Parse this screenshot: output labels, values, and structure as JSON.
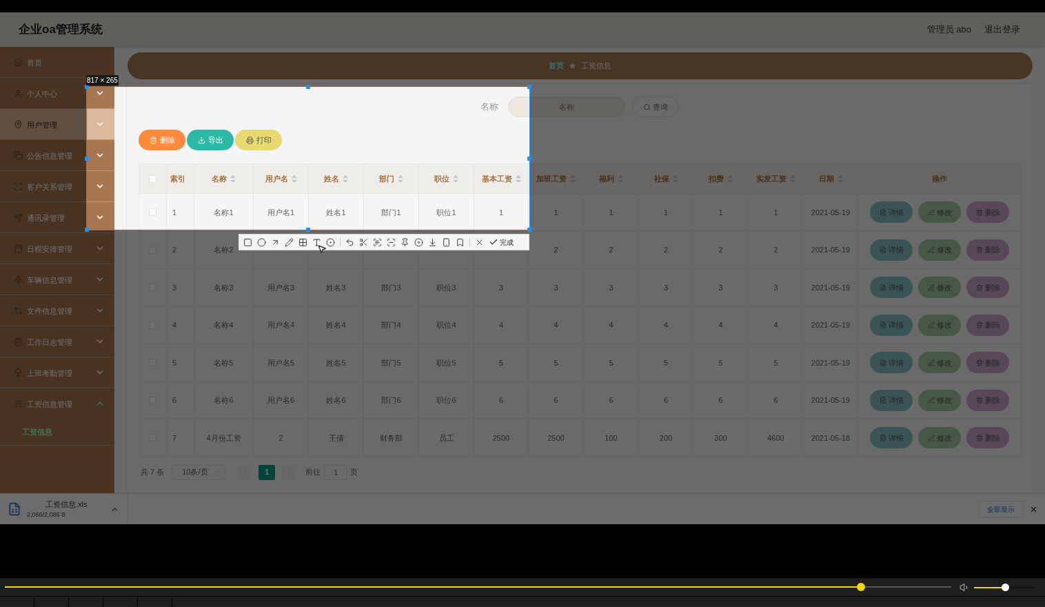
{
  "app": {
    "title": "企业oa管理系统",
    "user": "管理员 abo",
    "logout": "退出登录"
  },
  "sidebar": {
    "items": [
      {
        "label": "首页",
        "kind": "link",
        "hovered": false
      },
      {
        "label": "个人中心",
        "kind": "menu",
        "expanded": false,
        "hovered": false
      },
      {
        "label": "用户管理",
        "kind": "menu",
        "expanded": false,
        "hovered": true
      },
      {
        "label": "公告信息管理",
        "kind": "menu",
        "expanded": false,
        "hovered": false
      },
      {
        "label": "客户关系管理",
        "kind": "menu",
        "expanded": false,
        "hovered": false
      },
      {
        "label": "通讯录管理",
        "kind": "menu",
        "expanded": false,
        "hovered": false
      },
      {
        "label": "日程安排管理",
        "kind": "menu",
        "expanded": false,
        "hovered": false
      },
      {
        "label": "车辆信息管理",
        "kind": "menu",
        "expanded": false,
        "hovered": false
      },
      {
        "label": "文件信息管理",
        "kind": "menu",
        "expanded": false,
        "hovered": false
      },
      {
        "label": "工作日志管理",
        "kind": "menu",
        "expanded": false,
        "hovered": false
      },
      {
        "label": "上班考勤管理",
        "kind": "menu",
        "expanded": false,
        "hovered": false
      },
      {
        "label": "工资信息管理",
        "kind": "menu",
        "expanded": true,
        "hovered": false,
        "children": [
          {
            "label": "工资信息",
            "selected": true
          }
        ]
      }
    ]
  },
  "breadcrumb": [
    "首页",
    "工资信息"
  ],
  "search": {
    "label": "名称",
    "placeholder": "名称",
    "button": "查询"
  },
  "actions": [
    {
      "label": "删除",
      "kind": "delete"
    },
    {
      "label": "导出",
      "kind": "export"
    },
    {
      "label": "打印",
      "kind": "print"
    }
  ],
  "table": {
    "all_checked": false,
    "columns": [
      {
        "label": "索引",
        "kind": "text",
        "sortable": false
      },
      {
        "label": "名称",
        "kind": "text",
        "sortable": true
      },
      {
        "label": "用户名",
        "kind": "text",
        "sortable": true
      },
      {
        "label": "姓名",
        "kind": "text",
        "sortable": true
      },
      {
        "label": "部门",
        "kind": "text",
        "sortable": true
      },
      {
        "label": "职位",
        "kind": "text",
        "sortable": true
      },
      {
        "label": "基本工资",
        "kind": "text",
        "sortable": true
      },
      {
        "label": "加班工资",
        "kind": "text",
        "sortable": true
      },
      {
        "label": "福利",
        "kind": "text",
        "sortable": true
      },
      {
        "label": "社保",
        "kind": "text",
        "sortable": true
      },
      {
        "label": "扣费",
        "kind": "text",
        "sortable": true
      },
      {
        "label": "实发工资",
        "kind": "text",
        "sortable": true
      },
      {
        "label": "日期",
        "kind": "text",
        "sortable": true
      },
      {
        "label": "操作",
        "kind": "actions",
        "sortable": false
      }
    ],
    "rows": [
      {
        "checked": false,
        "cells": [
          "1",
          "名称1",
          "用户名1",
          "姓名1",
          "部门1",
          "职位1",
          "1",
          "1",
          "1",
          "1",
          "1",
          "1",
          "2021-05-19"
        ],
        "actions": [
          "详情",
          "修改",
          "删除"
        ]
      },
      {
        "checked": false,
        "cells": [
          "2",
          "名称2",
          null,
          null,
          null,
          null,
          null,
          "2",
          "2",
          "2",
          "2",
          "2",
          "2021-05-19"
        ],
        "actions": [
          "详情",
          "修改",
          "删除"
        ]
      },
      {
        "checked": false,
        "cells": [
          "3",
          "名称3",
          "用户名3",
          "姓名3",
          "部门3",
          "职位3",
          "3",
          "3",
          "3",
          "3",
          "3",
          "3",
          "2021-05-19"
        ],
        "actions": [
          "详情",
          "修改",
          "删除"
        ]
      },
      {
        "checked": false,
        "cells": [
          "4",
          "名称4",
          "用户名4",
          "姓名4",
          "部门4",
          "职位4",
          "4",
          "4",
          "4",
          "4",
          "4",
          "4",
          "2021-05-19"
        ],
        "actions": [
          "详情",
          "修改",
          "删除"
        ]
      },
      {
        "checked": false,
        "cells": [
          "5",
          "名称5",
          "用户名5",
          "姓名5",
          "部门5",
          "职位5",
          "5",
          "5",
          "5",
          "5",
          "5",
          "5",
          "2021-05-19"
        ],
        "actions": [
          "详情",
          "修改",
          "删除"
        ]
      },
      {
        "checked": false,
        "cells": [
          "6",
          "名称6",
          "用户名6",
          "姓名6",
          "部门6",
          "职位6",
          "6",
          "6",
          "6",
          "6",
          "6",
          "6",
          "2021-05-19"
        ],
        "actions": [
          "详情",
          "修改",
          "删除"
        ]
      },
      {
        "checked": false,
        "cells": [
          "7",
          "4月份工资",
          "2",
          "王倩",
          "财务部",
          "员工",
          "2500",
          "2500",
          "100",
          "200",
          "300",
          "4600",
          "2021-05-18"
        ],
        "actions": [
          "详情",
          "修改",
          "删除"
        ]
      }
    ]
  },
  "pagination": {
    "total": "共 7 条",
    "page_size": "10条/页",
    "pages": [
      {
        "label": "1",
        "selected": true
      }
    ],
    "goto_label": "前往",
    "goto_value": "1",
    "goto_suffix": "页"
  },
  "download": {
    "file": "工资信息.xls",
    "size": "2,086/2,086 B",
    "show_all": "全部显示"
  },
  "capture": {
    "size_label": "817 × 265",
    "confirm": "完成"
  },
  "player": {
    "progress": {
      "level": 0.9
    },
    "volume": {
      "level": 0.45
    }
  }
}
